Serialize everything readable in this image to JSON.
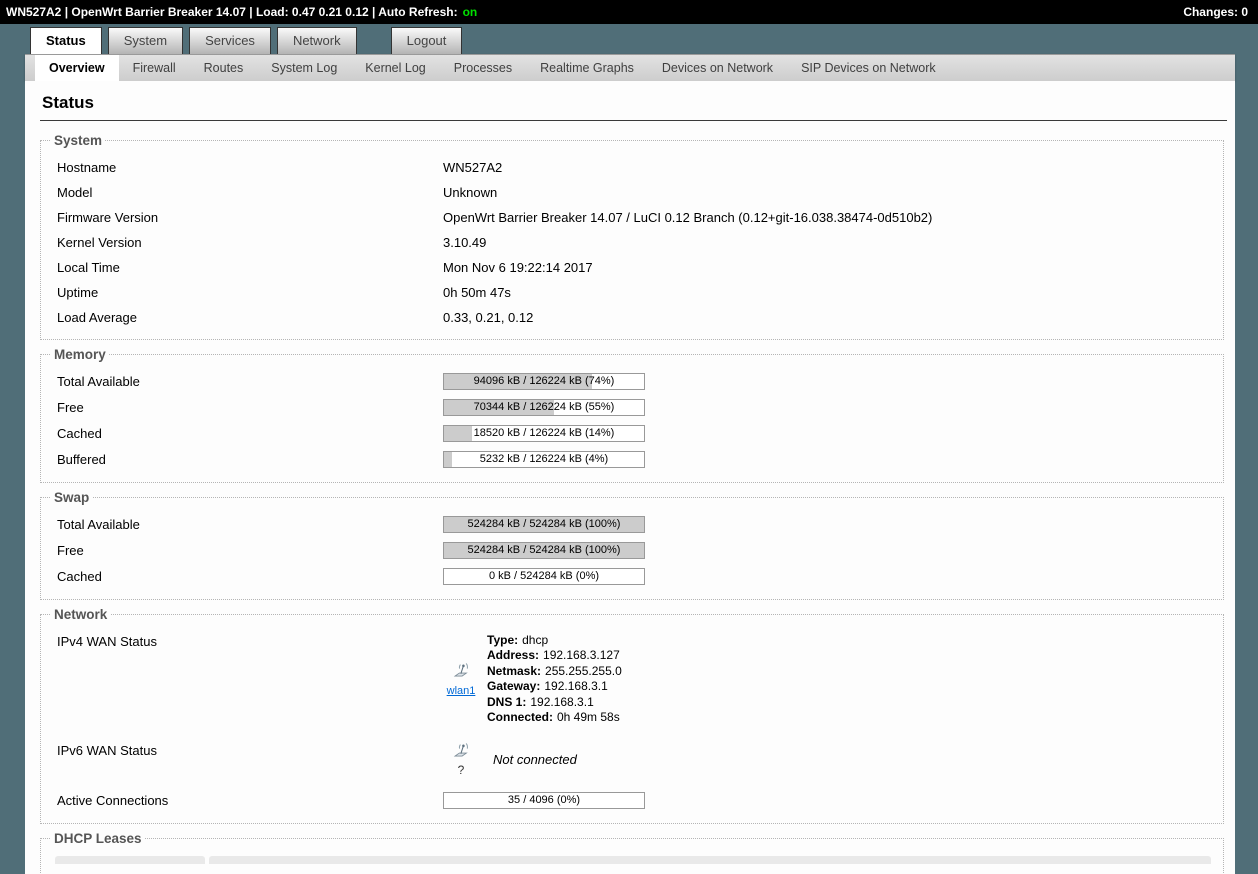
{
  "topbar": {
    "left_text": "WN527A2 | OpenWrt Barrier Breaker 14.07 | Load: 0.47 0.21 0.12 | Auto Refresh:",
    "auto_refresh_state": "on",
    "right_text": "Changes: 0",
    "accent_on_color": "#00e000"
  },
  "nav": {
    "tabs": [
      {
        "label": "Status"
      },
      {
        "label": "System"
      },
      {
        "label": "Services"
      },
      {
        "label": "Network"
      },
      {
        "label": "Logout"
      }
    ],
    "subtabs": [
      {
        "label": "Overview"
      },
      {
        "label": "Firewall"
      },
      {
        "label": "Routes"
      },
      {
        "label": "System Log"
      },
      {
        "label": "Kernel Log"
      },
      {
        "label": "Processes"
      },
      {
        "label": "Realtime Graphs"
      },
      {
        "label": "Devices on Network"
      },
      {
        "label": "SIP Devices on Network"
      }
    ]
  },
  "page_title": "Status",
  "system": {
    "legend": "System",
    "rows": [
      {
        "label": "Hostname",
        "value": "WN527A2"
      },
      {
        "label": "Model",
        "value": "Unknown"
      },
      {
        "label": "Firmware Version",
        "value": "OpenWrt Barrier Breaker 14.07 / LuCI 0.12 Branch (0.12+git-16.038.38474-0d510b2)"
      },
      {
        "label": "Kernel Version",
        "value": "3.10.49"
      },
      {
        "label": "Local Time",
        "value": "Mon Nov 6 19:22:14 2017"
      },
      {
        "label": "Uptime",
        "value": "0h 50m 47s"
      },
      {
        "label": "Load Average",
        "value": "0.33, 0.21, 0.12"
      }
    ]
  },
  "memory": {
    "legend": "Memory",
    "rows": [
      {
        "label": "Total Available",
        "text": "94096 kB / 126224 kB (74%)",
        "percent": 74
      },
      {
        "label": "Free",
        "text": "70344 kB / 126224 kB (55%)",
        "percent": 55
      },
      {
        "label": "Cached",
        "text": "18520 kB / 126224 kB (14%)",
        "percent": 14
      },
      {
        "label": "Buffered",
        "text": "5232 kB / 126224 kB (4%)",
        "percent": 4
      }
    ]
  },
  "swap": {
    "legend": "Swap",
    "rows": [
      {
        "label": "Total Available",
        "text": "524284 kB / 524284 kB (100%)",
        "percent": 100
      },
      {
        "label": "Free",
        "text": "524284 kB / 524284 kB (100%)",
        "percent": 100
      },
      {
        "label": "Cached",
        "text": "0 kB / 524284 kB (0%)",
        "percent": 0
      }
    ]
  },
  "network": {
    "legend": "Network",
    "ipv4": {
      "label": "IPv4 WAN Status",
      "interface": "wlan1",
      "details": [
        {
          "label": "Type:",
          "value": "dhcp"
        },
        {
          "label": "Address:",
          "value": "192.168.3.127"
        },
        {
          "label": "Netmask:",
          "value": "255.255.255.0"
        },
        {
          "label": "Gateway:",
          "value": "192.168.3.1"
        },
        {
          "label": "DNS 1:",
          "value": "192.168.3.1"
        },
        {
          "label": "Connected:",
          "value": "0h 49m 58s"
        }
      ]
    },
    "ipv6": {
      "label": "IPv6 WAN Status",
      "icon_label": "?",
      "status": "Not connected"
    },
    "connections": {
      "label": "Active Connections",
      "text": "35 / 4096 (0%)",
      "percent": 0
    }
  },
  "dhcp": {
    "legend": "DHCP Leases"
  }
}
